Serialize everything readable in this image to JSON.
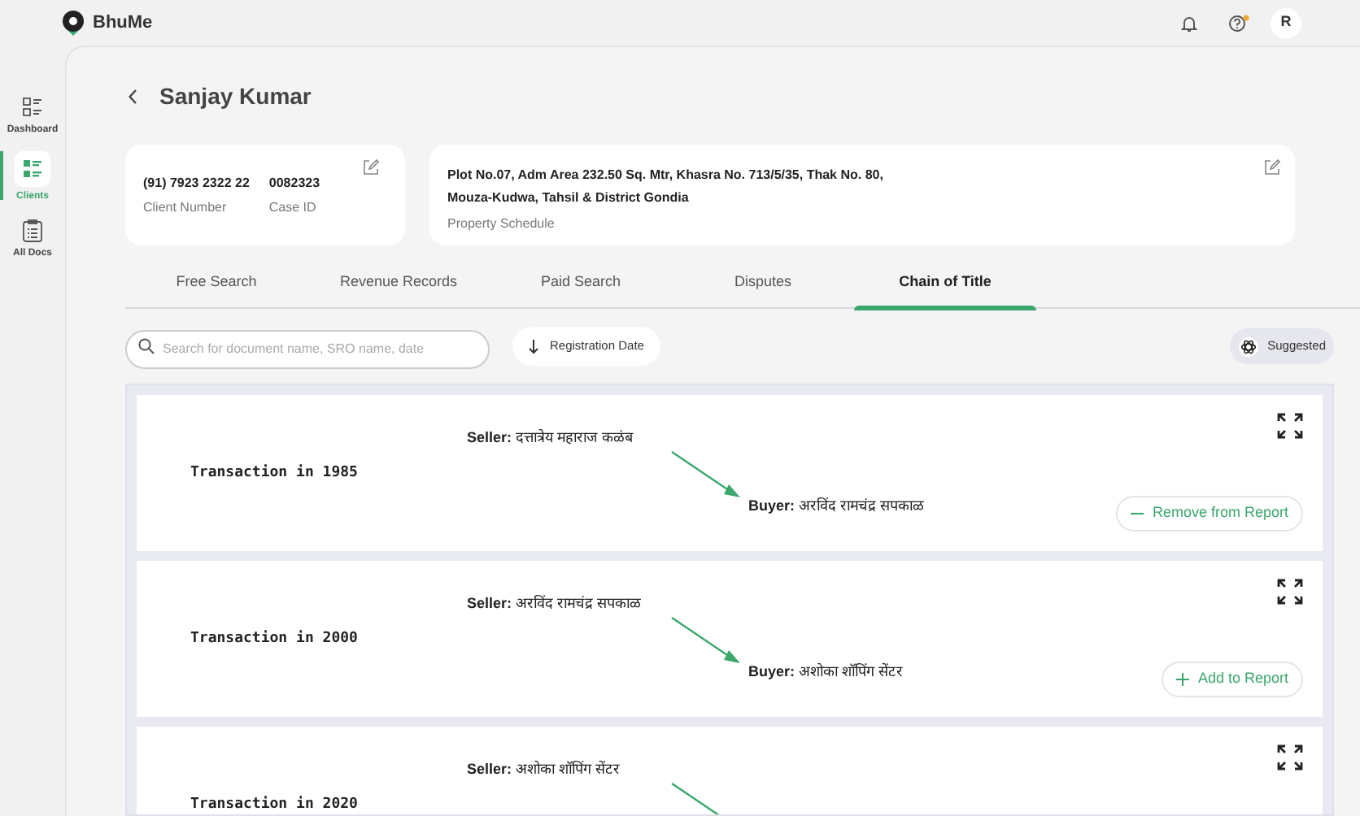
{
  "app": {
    "name": "BhuMe",
    "avatar": "R",
    "help_has_notification": true
  },
  "sidebar": {
    "items": [
      {
        "label": "Dashboard",
        "kind": "dashboard",
        "selected": false
      },
      {
        "label": "Clients",
        "kind": "clients",
        "selected": true
      },
      {
        "label": "All Docs",
        "kind": "docs",
        "selected": false
      }
    ]
  },
  "client": {
    "name": "Sanjay Kumar",
    "phone": "(91) 7923 2322 22",
    "phone_label": "Client Number",
    "case_id": "0082323",
    "case_id_label": "Case ID",
    "property_lines": [
      "Plot No.07, Adm Area 232.50 Sq. Mtr, Khasra No. 713/5/35, Thak No. 80,",
      "Mouza-Kudwa, Tahsil & District Gondia"
    ],
    "property_label": "Property Schedule"
  },
  "tabs": [
    {
      "label": "Free Search",
      "selected": false
    },
    {
      "label": "Revenue Records",
      "selected": false
    },
    {
      "label": "Paid Search",
      "selected": false
    },
    {
      "label": "Disputes",
      "selected": false
    },
    {
      "label": "Chain of Title",
      "selected": true
    }
  ],
  "search": {
    "placeholder": "Search for document name, SRO name, date"
  },
  "sort": {
    "label": "Registration Date"
  },
  "suggested": {
    "label": "Suggested"
  },
  "transactions": [
    {
      "title": "Transaction in 1985",
      "seller_label": "Seller:",
      "seller": "दत्तात्रेय महाराज कळंब",
      "buyer_label": "Buyer:",
      "buyer": "अरविंद रामचंद्र सपकाळ",
      "action": {
        "kind": "remove",
        "label": "Remove from Report"
      }
    },
    {
      "title": "Transaction in 2000",
      "seller_label": "Seller:",
      "seller": "अरविंद रामचंद्र सपकाळ",
      "buyer_label": "Buyer:",
      "buyer": "अशोका शॉपिंग सेंटर",
      "action": {
        "kind": "add",
        "label": "Add to Report"
      }
    },
    {
      "title": "Transaction in 2020",
      "seller_label": "Seller:",
      "seller": "अशोका शॉपिंग सेंटर"
    }
  ]
}
